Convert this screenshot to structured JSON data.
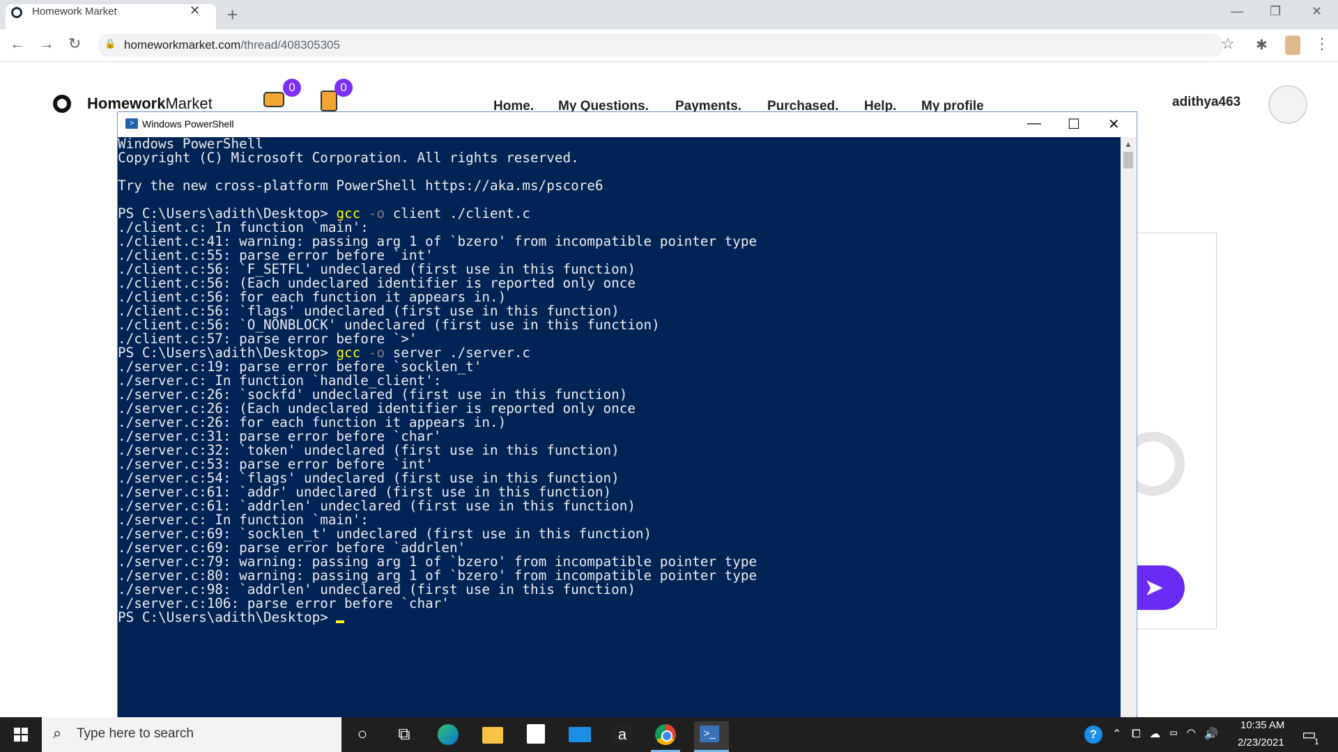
{
  "browser": {
    "tab_title": "Homework Market",
    "tab_close": "✕",
    "new_tab": "+",
    "url_host": "homeworkmarket.com",
    "url_path": "/thread/408305305",
    "back": "←",
    "forward": "→",
    "reload": "↻",
    "star": "☆",
    "kebab": "⋮",
    "min": "—",
    "restore": "❐",
    "close": "✕"
  },
  "site": {
    "brand_bold": "Homework",
    "brand_regular": "Market",
    "chat_badge": "0",
    "hand_badge": "0",
    "nav": [
      "Home.",
      "My Questions.",
      "Payments.",
      "Purchased.",
      "Help.",
      "My profile"
    ],
    "username": "adithya463",
    "send_icon": "➤"
  },
  "powershell": {
    "title": "Windows PowerShell",
    "min": "—",
    "max": "☐",
    "close": "✕",
    "header": [
      "Windows PowerShell",
      "Copyright (C) Microsoft Corporation. All rights reserved.",
      "",
      "Try the new cross-platform PowerShell https://aka.ms/pscore6",
      ""
    ],
    "prompt": "PS C:\\Users\\adith\\Desktop> ",
    "cmd1": {
      "exe": "gcc",
      "flag": "-o",
      "args": "client ./client.c"
    },
    "output1": [
      "./client.c: In function `main':",
      "./client.c:41: warning: passing arg 1 of `bzero' from incompatible pointer type",
      "./client.c:55: parse error before `int'",
      "./client.c:56: `F_SETFL' undeclared (first use in this function)",
      "./client.c:56: (Each undeclared identifier is reported only once",
      "./client.c:56: for each function it appears in.)",
      "./client.c:56: `flags' undeclared (first use in this function)",
      "./client.c:56: `O_NONBLOCK' undeclared (first use in this function)",
      "./client.c:57: parse error before `>'"
    ],
    "cmd2": {
      "exe": "gcc",
      "flag": "-o",
      "args": "server ./server.c"
    },
    "output2": [
      "./server.c:19: parse error before `socklen_t'",
      "./server.c: In function `handle_client':",
      "./server.c:26: `sockfd' undeclared (first use in this function)",
      "./server.c:26: (Each undeclared identifier is reported only once",
      "./server.c:26: for each function it appears in.)",
      "./server.c:31: parse error before `char'",
      "./server.c:32: `token' undeclared (first use in this function)",
      "./server.c:53: parse error before `int'",
      "./server.c:54: `flags' undeclared (first use in this function)",
      "./server.c:61: `addr' undeclared (first use in this function)",
      "./server.c:61: `addrlen' undeclared (first use in this function)",
      "./server.c: In function `main':",
      "./server.c:69: `socklen_t' undeclared (first use in this function)",
      "./server.c:69: parse error before `addrlen'",
      "./server.c:79: warning: passing arg 1 of `bzero' from incompatible pointer type",
      "./server.c:80: warning: passing arg 1 of `bzero' from incompatible pointer type",
      "./server.c:98: `addrlen' undeclared (first use in this function)",
      "./server.c:106: parse error before `char'"
    ],
    "colors": {
      "background": "#012456",
      "text": "#eeedf0",
      "command": "#ffff00",
      "flag": "#808080"
    }
  },
  "taskbar": {
    "search_placeholder": "Type here to search",
    "search_icon": "⌕",
    "cortana_icon": "○",
    "taskview_icon": "⧉",
    "amazon_icon": "a",
    "ps_icon": ">_",
    "help_icon": "?",
    "tray_up": "⌃",
    "tray_icons": "⧠ ☁ ▭ ◠ 🔊",
    "time": "10:35 AM",
    "date": "2/23/2021",
    "notification_icon": "▭",
    "notification_count": "1"
  }
}
